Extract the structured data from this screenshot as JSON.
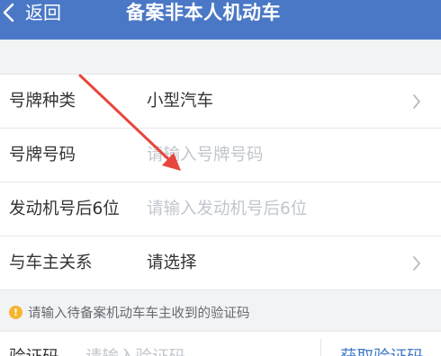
{
  "header": {
    "back_label": "返回",
    "title": "备案非本人机动车"
  },
  "form": {
    "rows": [
      {
        "label": "号牌种类",
        "value": "小型汽车",
        "placeholder": "",
        "chevron": true
      },
      {
        "label": "号牌号码",
        "value": "",
        "placeholder": "请输入号牌号码",
        "chevron": false
      },
      {
        "label": "发动机号后6位",
        "value": "",
        "placeholder": "请输入发动机号后6位",
        "chevron": false
      },
      {
        "label": "与车主关系",
        "value": "请选择",
        "placeholder": "",
        "chevron": true
      }
    ]
  },
  "hint": {
    "icon": "warning-icon",
    "text": "请输入待备案机动车车主收到的验证码"
  },
  "verify": {
    "label": "验证码",
    "placeholder": "请输入验证码",
    "get_code_label": "获取验证码"
  },
  "colors": {
    "header_bg": "#4a78c6",
    "link": "#3f78c9",
    "annotation_arrow": "#e8453c",
    "warning": "#f5b52e"
  }
}
